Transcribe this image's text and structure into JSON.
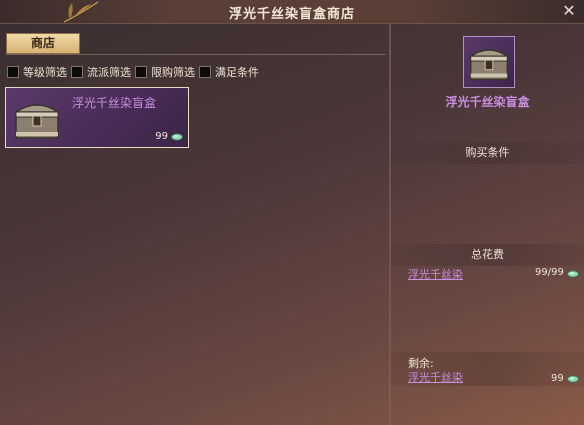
{
  "window": {
    "title": "浮光千丝染盲盒商店"
  },
  "tabs": [
    {
      "label": "商店"
    }
  ],
  "filters": [
    {
      "label": "等级筛选"
    },
    {
      "label": "流派筛选"
    },
    {
      "label": "限购筛选"
    },
    {
      "label": "满足条件"
    }
  ],
  "items": [
    {
      "name": "浮光千丝染盲盒",
      "count": "99",
      "icon": "chest-icon"
    }
  ],
  "detail": {
    "name": "浮光千丝染盲盒",
    "requirements_label": "购买条件",
    "total_cost_label": "总花费",
    "cost_item": "浮光千丝染",
    "cost_value": "99/99",
    "remaining_label": "剩余:",
    "remaining_item": "浮光千丝染",
    "remaining_value": "99"
  },
  "colors": {
    "accent": "#c98ee0",
    "tab": "#e6c68a",
    "panel_bg": "#4a3638"
  }
}
